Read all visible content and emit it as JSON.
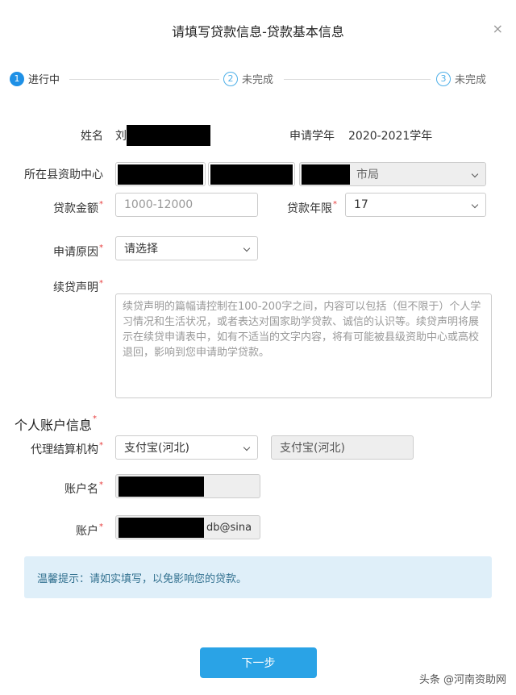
{
  "dialog": {
    "title": "请填写贷款信息-贷款基本信息",
    "close_symbol": "×"
  },
  "steps": [
    {
      "num": "1",
      "label": "进行中",
      "state": "active"
    },
    {
      "num": "2",
      "label": "未完成",
      "state": "pending"
    },
    {
      "num": "3",
      "label": "未完成",
      "state": "pending"
    }
  ],
  "form": {
    "name_label": "姓名",
    "name_value": "刘",
    "year_label": "申请学年",
    "year_value": "2020-2021学年",
    "center_label": "所在县资助中心",
    "center_value_suffix": "市局",
    "amount_label": "贷款金额",
    "amount_placeholder": "1000-12000",
    "term_label": "贷款年限",
    "term_value": "17",
    "reason_label": "申请原因",
    "reason_value": "请选择",
    "statement_label": "续贷声明",
    "statement_placeholder": "续贷声明的篇幅请控制在100-200字之间，内容可以包括（但不限于）个人学习情况和生活状况，或者表达对国家助学贷款、诚信的认识等。续贷声明将展示在续贷申请表中，如有不适当的文字内容，将有可能被县级资助中心或高校退回，影响到您申请助学贷款。"
  },
  "account": {
    "section_title": "个人账户信息",
    "agency_label": "代理结算机构",
    "agency_value": "支付宝(河北)",
    "agency_display": "支付宝(河北)",
    "account_name_label": "账户名",
    "account_label": "账户",
    "account_value_suffix": "db@sina"
  },
  "notice": {
    "text": "温馨提示：请如实填写，以免影响您的贷款。"
  },
  "next_button": "下一步",
  "watermark": "头条 @河南资助网",
  "colors": {
    "accent": "#1e90e6",
    "button": "#2aa3e6",
    "notice_bg": "#dfeff9",
    "required": "#e84040"
  }
}
